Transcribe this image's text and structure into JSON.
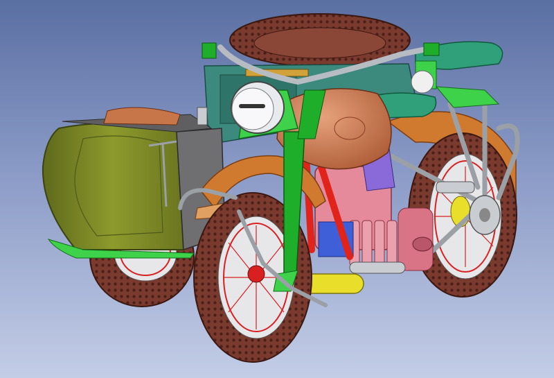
{
  "scene": {
    "subject_icon": "sidecar-motorcycle-cad-model",
    "colors": {
      "bg_top": "#5a6fa2",
      "bg_bottom": "#c3cde6",
      "sidecar": "#7e8a26",
      "sidecar_dark": "#4f5a1a",
      "tank": "#c7764a",
      "fender": "#d07a2f",
      "fender_light": "#e0a062",
      "frame_green": "#1fae2a",
      "frame_bright": "#3ed14a",
      "frame_red": "#e0241c",
      "engine": "#e58a9a",
      "engine_dark": "#b8566a",
      "body_teal": "#3c8a7e",
      "tire": "#7a3a2e",
      "tire_dark": "#4c201a",
      "spoke_red": "#d82020",
      "chrome": "#c9cdd2",
      "seat": "#2fa07a",
      "yellow_part": "#e9df2a",
      "blue_part": "#3f5fd8",
      "purple_part": "#8a6ad8",
      "gray_panel": "#6f6f72"
    }
  }
}
